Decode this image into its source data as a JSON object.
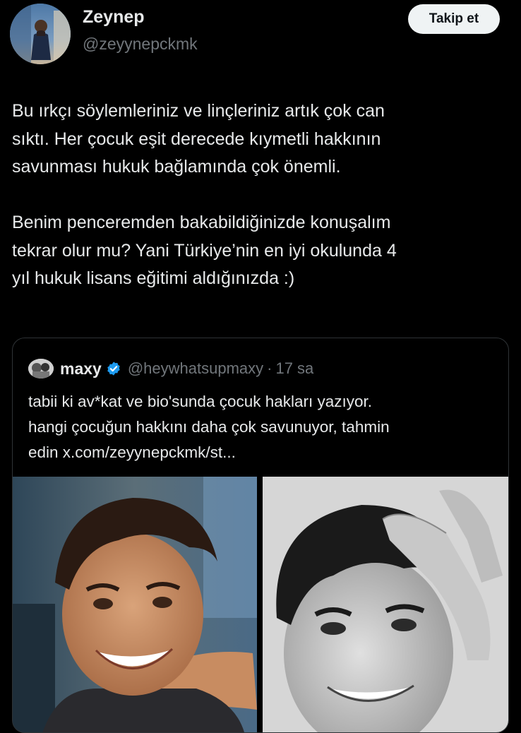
{
  "author": {
    "display_name": "Zeynep",
    "handle": "@zeyynepckmk",
    "avatar_icon": "profile-photo"
  },
  "follow_button": {
    "label": "Takip et"
  },
  "tweet": {
    "paragraph_1": "Bu ırkçı söylemleriniz ve linçleriniz artık çok can\nsıktı. Her çocuk eşit derecede kıymetli hakkının\nsavunması hukuk bağlamında çok önemli.",
    "paragraph_2": "Benim penceremden bakabildiğinizde konuşalım\ntekrar olur mu? Yani Türkiye’nin en iyi okulunda 4\nyıl hukuk lisans eğitimi aldığınızda :)"
  },
  "quoted_tweet": {
    "display_name": "maxy",
    "verified_icon": "verified-badge-icon",
    "handle": "@heywhatsupmaxy",
    "separator": "·",
    "time": "17 sa",
    "text": "tabii ki av*kat ve bio'sunda çocuk hakları yazıyor.\nhangi çocuğun hakkını daha çok savunuyor, tahmin\nedin x.com/zeyynepckmk/st...",
    "media": [
      {
        "type": "photo",
        "description_icon": "photo-child-smiling"
      },
      {
        "type": "photo",
        "description_icon": "photo-teen-grayscale"
      }
    ]
  },
  "colors": {
    "background": "#000000",
    "text_primary": "#e7e9ea",
    "text_secondary": "#71767b",
    "border": "#2f3336",
    "follow_bg": "#eff3f4",
    "verified_blue": "#1d9bf0"
  }
}
